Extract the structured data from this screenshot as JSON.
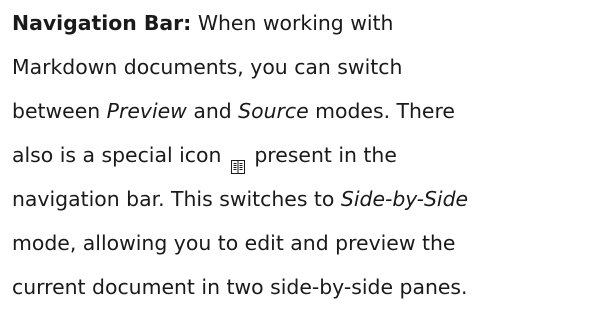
{
  "paragraph": {
    "heading": "Navigation Bar:",
    "l1_rest": " When working with",
    "l2": "Markdown documents, you can switch",
    "l3_a": "between ",
    "l3_preview": "Preview",
    "l3_b": " and ",
    "l3_source": "Source",
    "l3_c": " modes. There",
    "l4_a": "also is a special icon ",
    "l4_b": " present in the",
    "l5_a": "navigation bar. This switches to ",
    "l5_mode": "Side-by-Side",
    "l6": "mode, allowing you to edit and preview the",
    "l7": "current document in two side-by-side panes."
  },
  "icons": {
    "side_by_side": "side-by-side-icon"
  }
}
